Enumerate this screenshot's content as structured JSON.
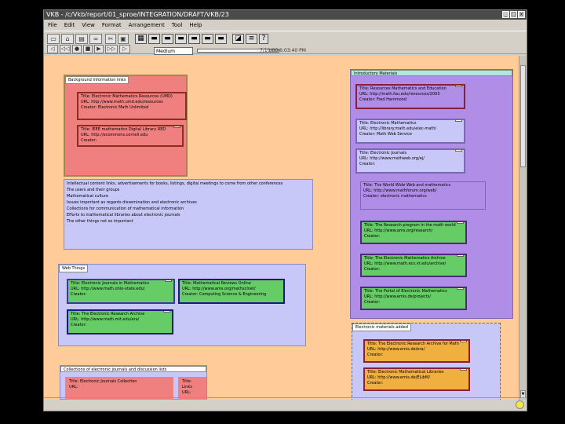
{
  "window": {
    "title": "VKB - /c/Vkb/report/01_sproe/INTEGRATION/DRAFT/VKB/23",
    "minimize": "_",
    "maximize": "□",
    "close": "x"
  },
  "menu": [
    "File",
    "Edit",
    "View",
    "Format",
    "Arrangement",
    "Tool",
    "Help"
  ],
  "toolbar": {
    "icons": [
      "collection-icon",
      "open-icon",
      "save-icon",
      "link-icon",
      "cut-icon",
      "paste-icon",
      "grid-icon",
      "style-1-icon",
      "style-2-icon",
      "style-3-icon",
      "style-4-icon",
      "style-5-icon",
      "style-6-icon",
      "arrange-icon",
      "note-icon",
      "find-icon"
    ],
    "zoom_label": "Medium",
    "timestamp": "7/10/00 6:03:40 PM",
    "history_fraction": 0.88
  },
  "colors": {
    "canvas": "#ffcc99",
    "salmon": "#f08080",
    "purple": "#b08ee8",
    "lavender": "#c8c8f8",
    "green": "#66cc66",
    "gold": "#f0b040"
  },
  "canvas": {
    "col_a": {
      "label": "Background Information links",
      "notes": [
        "Title: Electronic Mathematics Resources (UMD)\nURL: http://www.math.umd.edu/resources\nCreator: Electronic Math Unlimited",
        "Title: IEEE mathematics Digital Library RED\nURL: http://ecommons.cornell.edu\nCreator:"
      ]
    },
    "col_b": {
      "label": "Introductory Materials",
      "notes": [
        "Title: Resources Mathematics and Education\nURL: http://math.fau.edu/resources/2003\nCreator: Fred Hammond",
        "Title: Electronic Mathematics\nURL: http://library.math.edu/elec-math/\nCreator: Math Web Service",
        "Title: Electronic Journals\nURL: http://www.mathweb.org/ej/\nCreator:",
        "Title: The World Wide Web and mathematics\nURL: http://www.mathforum.org/web/\nCreator: electronic mathematics"
      ],
      "green_notes": [
        "Title: The Research program in the math world\nURL: http://www.ams.org/research/\nCreator:",
        "Title: The Electronic Mathematics Archive\nURL: http://www.math.ecs.vt.edu/archive/\nCreator:",
        "Title: The Portal of Electronic Mathematics\nURL: http://www.emis.de/projects/\nCreator:"
      ]
    },
    "text_area": "Intellectual content links, advertisements for books, listings, digital meetings to come from other conferences\nThe users and their groups\nMathematical culture\nIssues important as regards dissemination and electronic archives\nCollections for communication of mathematical information\nEfforts to mathematical libraries about electronic journals\nThe other things not so important",
    "col_c": {
      "label": "Web Things",
      "notes": [
        "Title: Electronic Journals in Mathematics\nURL: http://www.math.ohio-state.edu/\nCreator:",
        "Title: Mathematical Reviews Online\nURL: http://www.ams.org/mathscinet/\nCreator: Computing Science & Engineering",
        "Title: The Electronic Research Archive\nURL: http://www.math.mit.edu/era/\nCreator:"
      ]
    },
    "col_d": {
      "label": "Electronic materials added",
      "notes": [
        "Title: The Electronic Research Archive for Math\nURL: http://www.emis.de/era/\nCreator:",
        "Title: Electronic Mathematical Libraries\nURL: http://www.emis.de/ELibM/\nCreator:"
      ]
    },
    "col_e": {
      "label": "Collections of electronic journals and discussion lists",
      "notes": [
        "Title: Electronic Journals Collection\nURL:",
        "Title: Links\nURL:"
      ]
    }
  }
}
